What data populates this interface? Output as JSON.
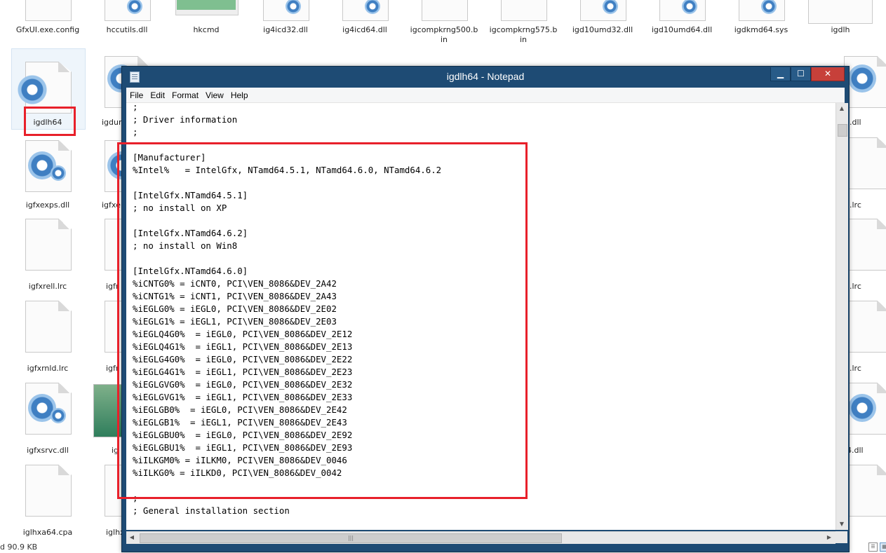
{
  "explorer": {
    "top_row_files": [
      {
        "name": "GfxUI.exe.config"
      },
      {
        "name": "hccutils.dll"
      },
      {
        "name": "hkcmd"
      },
      {
        "name": "ig4icd32.dll"
      },
      {
        "name": "ig4icd64.dll"
      },
      {
        "name": "igcompkrng500.b\nin"
      },
      {
        "name": "igcompkrng575.b\nin"
      },
      {
        "name": "igd10umd32.dll"
      },
      {
        "name": "igd10umd64.dll"
      },
      {
        "name": "igdkmd64.sys"
      },
      {
        "name": "igdlh"
      }
    ],
    "left_column_files": [
      {
        "name": "igdlh64"
      },
      {
        "name": "igfxexps.dll"
      },
      {
        "name": "igfxrell.lrc"
      },
      {
        "name": "igfxrnld.lrc"
      },
      {
        "name": "igfxsrvc.dll"
      },
      {
        "name": "iglhxa64.cpa"
      }
    ],
    "second_column_partial": [
      {
        "name": "igdur"
      },
      {
        "name": "igfxe"
      },
      {
        "name": "igfr"
      },
      {
        "name": "igfr"
      },
      {
        "name": "ig"
      },
      {
        "name": "iglhx"
      }
    ],
    "right_column_partial": [
      {
        "name": ".dll"
      },
      {
        "name": ".lrc"
      },
      {
        "name": ".lrc"
      },
      {
        "name": ".lrc"
      },
      {
        "name": "4.dll"
      },
      {
        "name": ""
      }
    ],
    "status_text": "d  90.9 KB"
  },
  "notepad": {
    "title": "igdlh64 - Notepad",
    "menu": [
      "File",
      "Edit",
      "Format",
      "View",
      "Help"
    ],
    "caption_buttons": {
      "minimize": "▁",
      "maximize": "☐",
      "close": "✕"
    },
    "lines": [
      ";",
      "; Driver information",
      ";",
      "",
      "[Manufacturer]",
      "%Intel%   = IntelGfx, NTamd64.5.1, NTamd64.6.0, NTamd64.6.2",
      "",
      "[IntelGfx.NTamd64.5.1]",
      "; no install on XP",
      "",
      "[IntelGfx.NTamd64.6.2]",
      "; no install on Win8",
      "",
      "[IntelGfx.NTamd64.6.0]",
      "%iCNTG0% = iCNT0, PCI\\VEN_8086&DEV_2A42",
      "%iCNTG1% = iCNT1, PCI\\VEN_8086&DEV_2A43",
      "%iEGLG0% = iEGL0, PCI\\VEN_8086&DEV_2E02",
      "%iEGLG1% = iEGL1, PCI\\VEN_8086&DEV_2E03",
      "%iEGLQ4G0%  = iEGL0, PCI\\VEN_8086&DEV_2E12",
      "%iEGLQ4G1%  = iEGL1, PCI\\VEN_8086&DEV_2E13",
      "%iEGLG4G0%  = iEGL0, PCI\\VEN_8086&DEV_2E22",
      "%iEGLG4G1%  = iEGL1, PCI\\VEN_8086&DEV_2E23",
      "%iEGLGVG0%  = iEGL0, PCI\\VEN_8086&DEV_2E32",
      "%iEGLGVG1%  = iEGL1, PCI\\VEN_8086&DEV_2E33",
      "%iEGLGB0%  = iEGL0, PCI\\VEN_8086&DEV_2E42",
      "%iEGLGB1%  = iEGL1, PCI\\VEN_8086&DEV_2E43",
      "%iEGLGBU0%  = iEGL0, PCI\\VEN_8086&DEV_2E92",
      "%iEGLGBU1%  = iEGL1, PCI\\VEN_8086&DEV_2E93",
      "%iILKGM0% = iILKM0, PCI\\VEN_8086&DEV_0046",
      "%iILKG0% = iILKD0, PCI\\VEN_8086&DEV_0042",
      "",
      ";",
      "; General installation section"
    ]
  },
  "colors": {
    "highlight": "#e8202a",
    "window_frame": "#1e4b74",
    "close_button": "#c7403a"
  }
}
